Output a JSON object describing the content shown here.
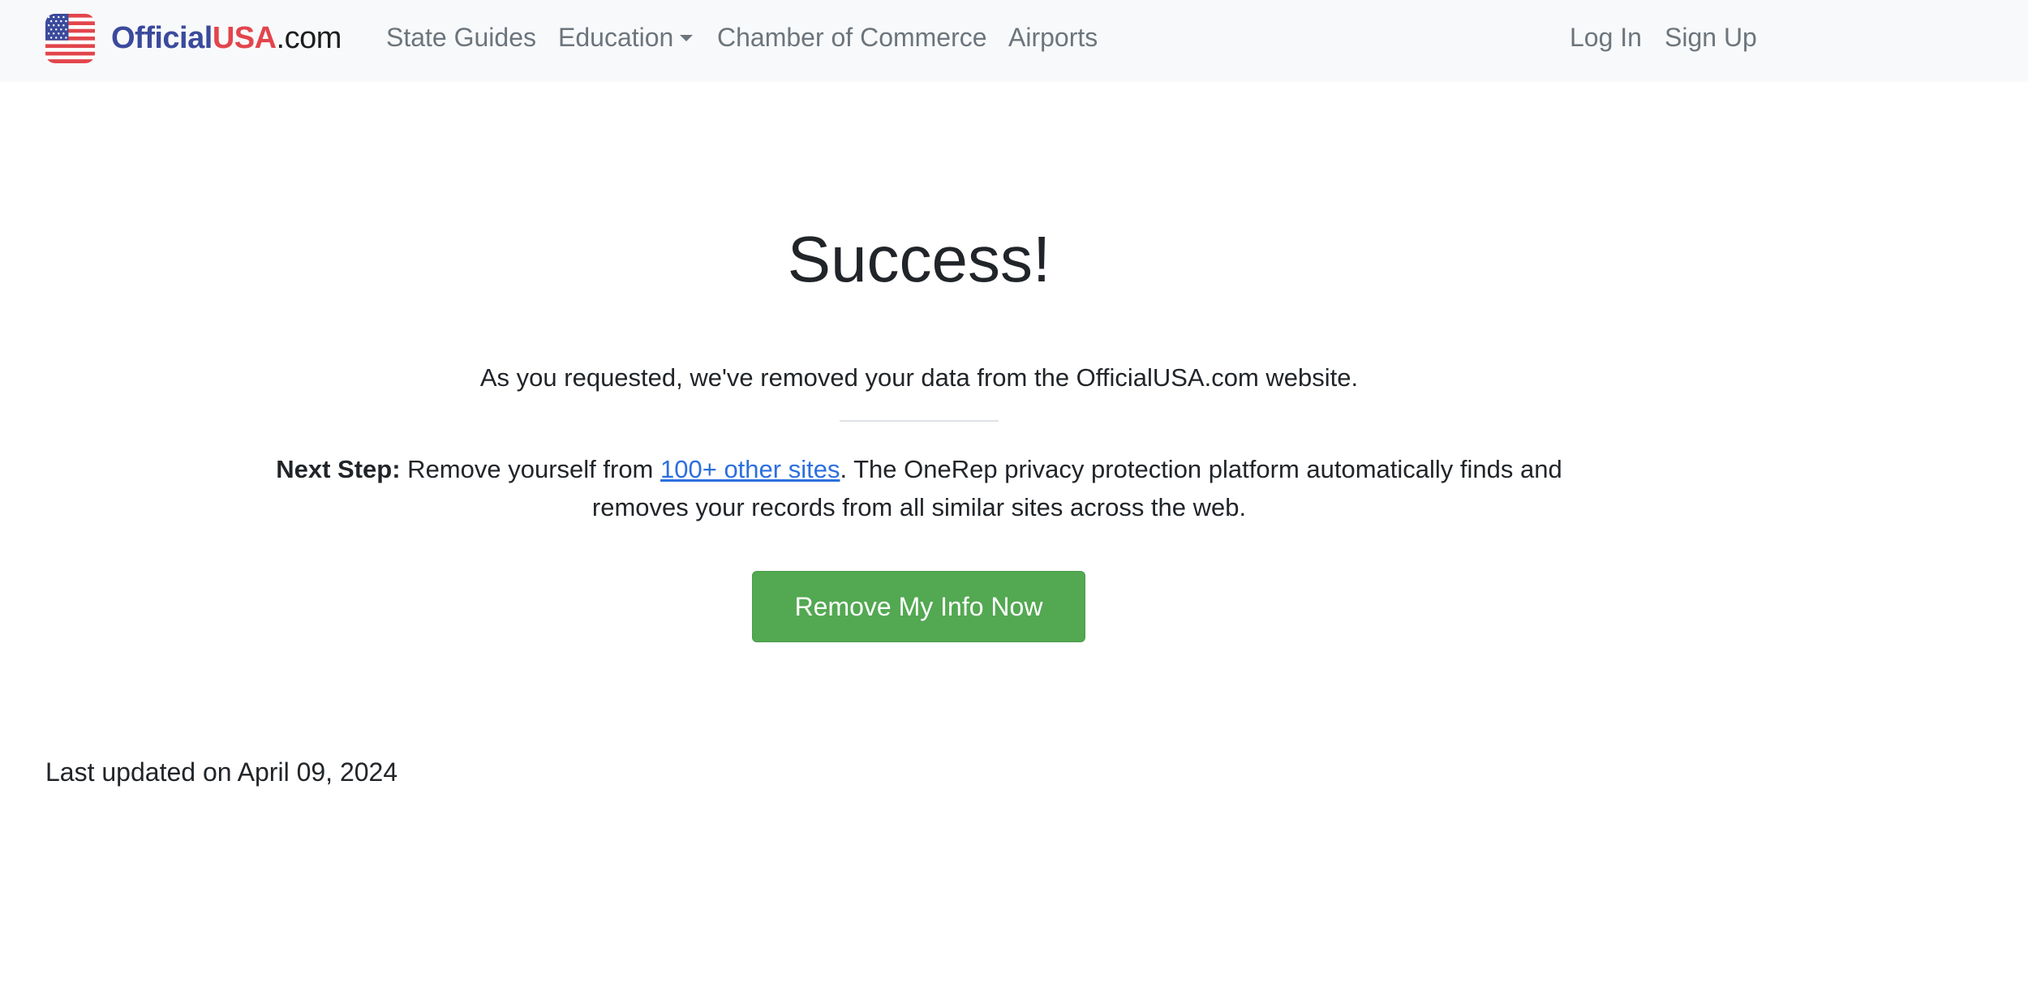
{
  "brand": {
    "part_official": "Official",
    "part_usa": "USA",
    "part_com": ".com",
    "logo_icon": "us-flag-icon"
  },
  "nav": {
    "state_guides": "State Guides",
    "education": "Education",
    "chamber": "Chamber of Commerce",
    "airports": "Airports",
    "log_in": "Log In",
    "sign_up": "Sign Up"
  },
  "main": {
    "title": "Success!",
    "message": "As you requested, we've removed your data from the OfficialUSA.com website.",
    "next_step_label": "Next Step:",
    "next_step_before_link": " Remove yourself from ",
    "next_step_link": "100+ other sites",
    "next_step_after_link": ". The OneRep privacy protection platform automatically finds and removes your records from all similar sites across the web.",
    "button_label": "Remove My Info Now",
    "last_updated": "Last updated on April 09, 2024"
  },
  "colors": {
    "navbar_bg": "#f8f9fa",
    "brand_blue": "#3b4a9c",
    "brand_red": "#e3454c",
    "nav_link": "#6c757d",
    "link": "#2c6fde",
    "button_green": "#53a852",
    "text": "#212529"
  }
}
